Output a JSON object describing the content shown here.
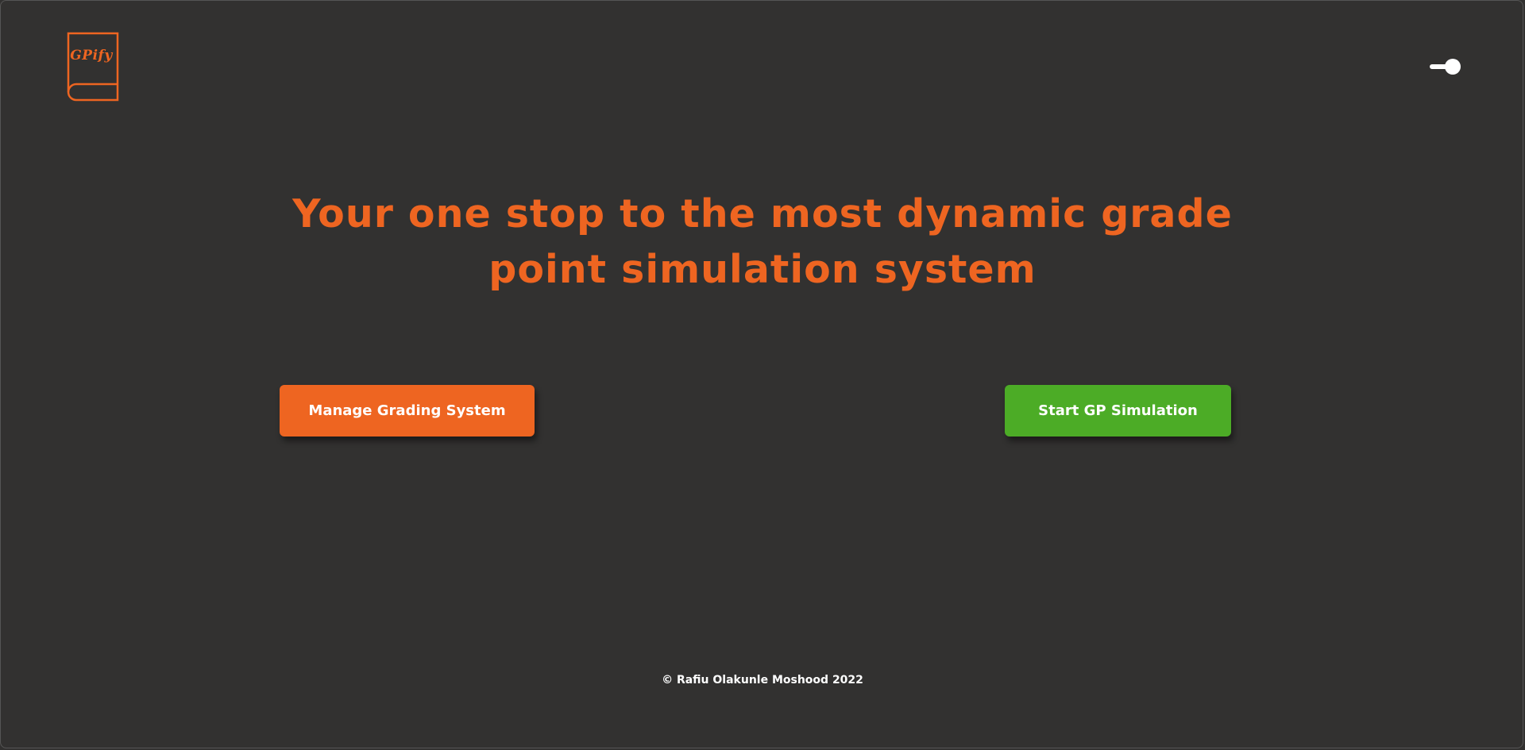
{
  "header": {
    "logo_text": "GPify",
    "logo_icon": "book-icon",
    "theme_toggle_icon": "toggle-switch-icon"
  },
  "hero": {
    "headline": "Your one stop to the most dynamic grade point simulation system"
  },
  "actions": {
    "manage_label": "Manage Grading System",
    "start_label": "Start GP Simulation"
  },
  "footer": {
    "copyright": "© Rafiu Olakunle Moshood 2022"
  },
  "colors": {
    "background": "#323130",
    "accent": "#ee6521",
    "primary_action": "#ee6521",
    "secondary_action": "#4cac26",
    "text_light": "#ffffff"
  }
}
